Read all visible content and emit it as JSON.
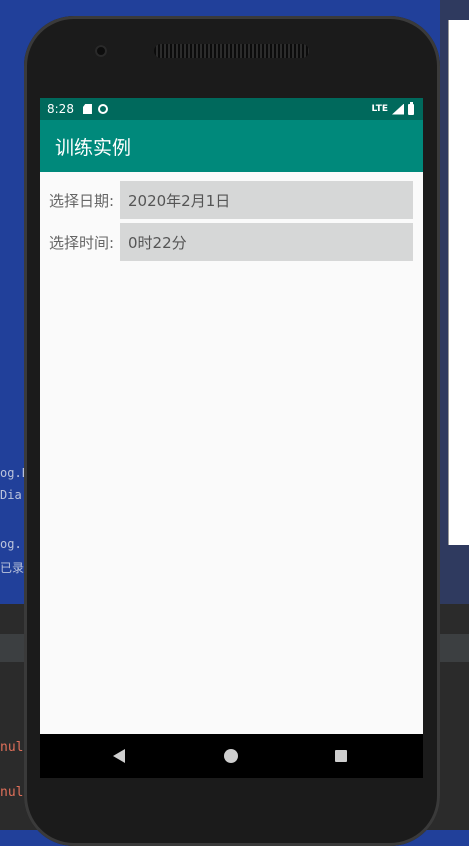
{
  "background": {
    "code_lines": [
      "og.E",
      "Dia",
      "og.",
      "已录"
    ],
    "error_lines": [
      "nul",
      "nul"
    ]
  },
  "status_bar": {
    "time": "8:28",
    "network": "LTE"
  },
  "app_bar": {
    "title": "训练实例"
  },
  "form": {
    "date_label": "选择日期:",
    "date_value": "2020年2月1日",
    "time_label": "选择时间:",
    "time_value": "0时22分"
  },
  "colors": {
    "status_bar": "#00695c",
    "app_bar": "#00897b",
    "field_bg": "#d6d7d7",
    "screen_bg": "#fafafa"
  },
  "nav_icons": [
    "back-icon",
    "home-icon",
    "recents-icon"
  ]
}
